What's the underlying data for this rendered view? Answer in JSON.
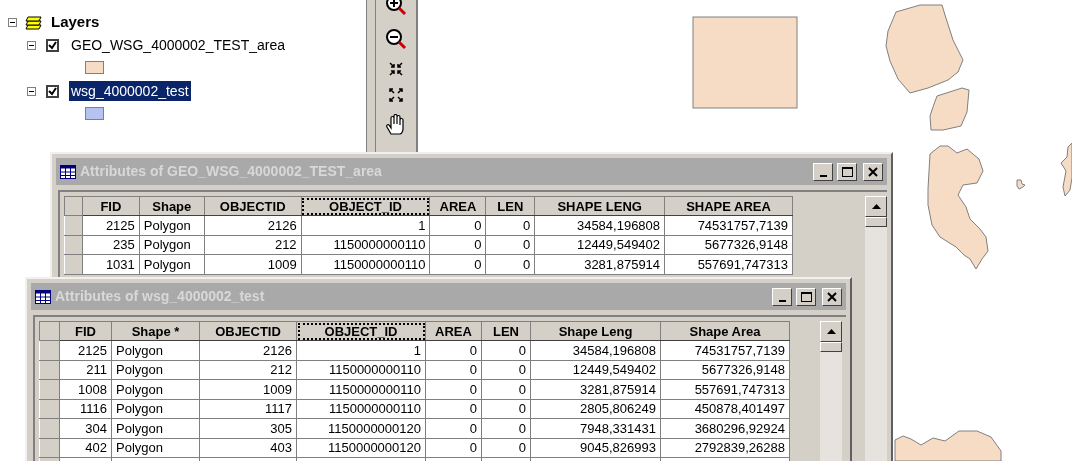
{
  "layers_panel": {
    "root": {
      "label": "Layers",
      "expanded": true,
      "children": [
        {
          "label": "GEO_WSG_4000002_TEST_area",
          "expanded": true,
          "checked": true,
          "selected": false,
          "color": "#f7dcc5"
        },
        {
          "label": "wsg_4000002_test",
          "expanded": true,
          "checked": true,
          "selected": true,
          "color": "#b4c3f0"
        }
      ]
    }
  },
  "windows": [
    {
      "title": "Attributes of GEO_WSG_4000002_TEST_area",
      "columns": [
        {
          "label": "FID",
          "focused": false
        },
        {
          "label": "Shape",
          "focused": false
        },
        {
          "label": "OBJECTID",
          "focused": false
        },
        {
          "label": "OBJECT_ID",
          "focused": true
        },
        {
          "label": "AREA",
          "focused": false
        },
        {
          "label": "LEN",
          "focused": false
        },
        {
          "label": "SHAPE LENG",
          "focused": false
        },
        {
          "label": "SHAPE AREA",
          "focused": false
        }
      ],
      "rows": [
        [
          "2125",
          "Polygon",
          "2126",
          "1",
          "0",
          "0",
          "34584,196808",
          "74531757,7139"
        ],
        [
          "235",
          "Polygon",
          "212",
          "1150000000110",
          "0",
          "0",
          "12449,549402",
          "5677326,9148"
        ],
        [
          "1031",
          "Polygon",
          "1009",
          "1150000000110",
          "0",
          "0",
          "3281,875914",
          "557691,747313"
        ]
      ]
    },
    {
      "title": "Attributes of wsg_4000002_test",
      "columns": [
        {
          "label": "FID",
          "focused": false
        },
        {
          "label": "Shape *",
          "focused": false
        },
        {
          "label": "OBJECTID",
          "focused": false
        },
        {
          "label": "OBJECT_ID",
          "focused": true
        },
        {
          "label": "AREA",
          "focused": false
        },
        {
          "label": "LEN",
          "focused": false
        },
        {
          "label": "Shape Leng",
          "focused": false
        },
        {
          "label": "Shape Area",
          "focused": false
        }
      ],
      "rows": [
        [
          "2125",
          "Polygon",
          "2126",
          "1",
          "0",
          "0",
          "34584,196808",
          "74531757,7139"
        ],
        [
          "211",
          "Polygon",
          "212",
          "1150000000110",
          "0",
          "0",
          "12449,549402",
          "5677326,9148"
        ],
        [
          "1008",
          "Polygon",
          "1009",
          "1150000000110",
          "0",
          "0",
          "3281,875914",
          "557691,747313"
        ],
        [
          "1116",
          "Polygon",
          "1117",
          "1150000000110",
          "0",
          "0",
          "2805,806249",
          "450878,401497"
        ],
        [
          "304",
          "Polygon",
          "305",
          "1150000000120",
          "0",
          "0",
          "7948,331431",
          "3680296,92924"
        ],
        [
          "402",
          "Polygon",
          "403",
          "1150000000120",
          "0",
          "0",
          "9045,826993",
          "2792839,26288"
        ]
      ]
    }
  ]
}
